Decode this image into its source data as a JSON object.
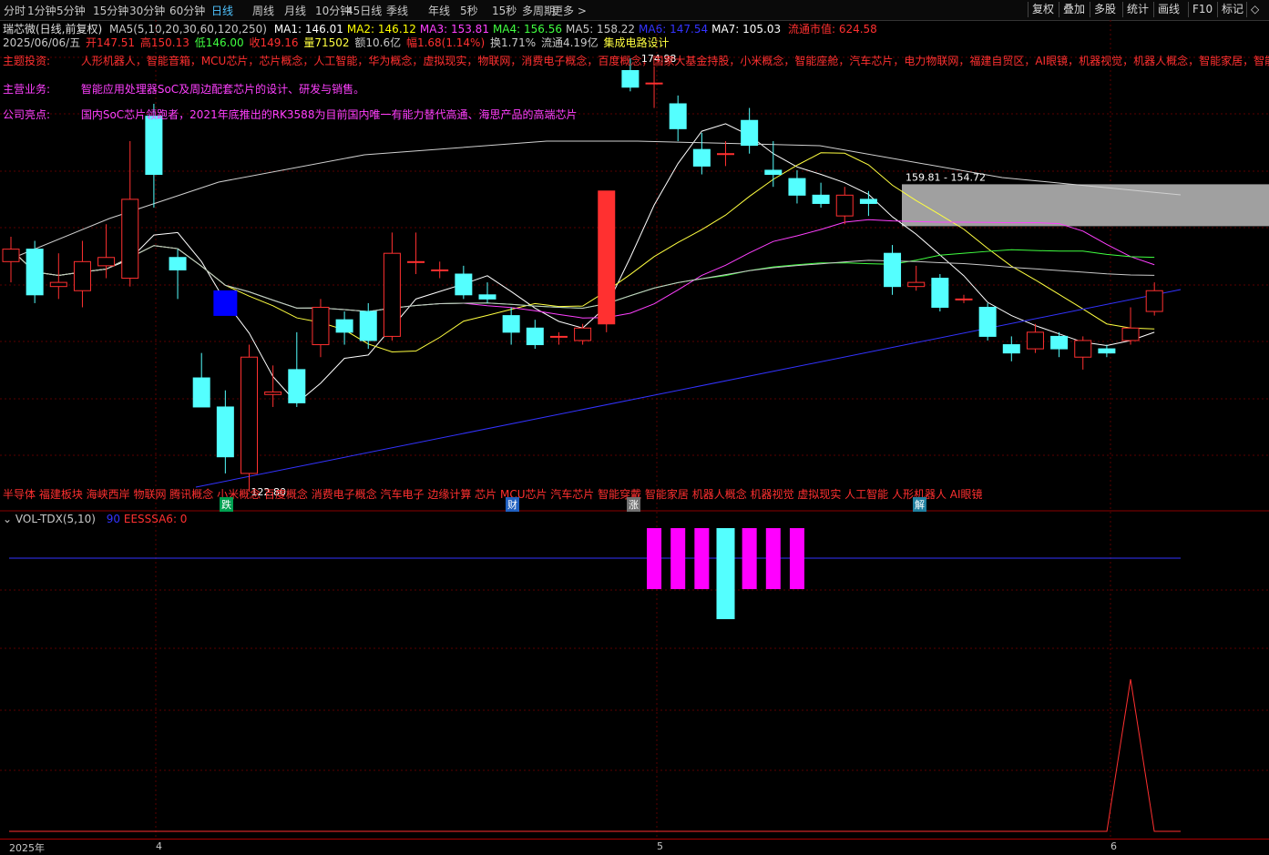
{
  "toolbar": {
    "timeframes": [
      "分时",
      "1分钟",
      "5分钟",
      "15分钟",
      "30分钟",
      "60分钟",
      "日线",
      "周线",
      "月线",
      "10分钟",
      "45日线",
      "季线",
      "年线",
      "5秒",
      "15秒",
      "多周期",
      "更多 >"
    ],
    "active_timeframe": "日线",
    "right_buttons": [
      "复权",
      "叠加",
      "多股",
      "统计",
      "画线",
      "F10",
      "标记",
      "◇"
    ]
  },
  "header": {
    "stock_name": "瑞芯微(日线,前复权)",
    "ma_params": "MA5(5,10,20,30,60,120,250)",
    "ma_values": [
      {
        "label": "MA1: 146.01",
        "color": "#ffffff"
      },
      {
        "label": "MA2: 146.12",
        "color": "#ffff00"
      },
      {
        "label": "MA3: 153.81",
        "color": "#ff40ff"
      },
      {
        "label": "MA4: 156.56",
        "color": "#40ff40"
      },
      {
        "label": "MA5: 158.22",
        "color": "#c8c8c8"
      },
      {
        "label": "MA6: 147.54",
        "color": "#3333ff"
      },
      {
        "label": "MA7: 105.03",
        "color": "#ffffff"
      }
    ],
    "float_mcap": "流通市值: 624.58"
  },
  "quote": {
    "date": "2025/06/06/五",
    "open": "开147.51",
    "high": "高150.13",
    "low": "低146.00",
    "close": "收149.16",
    "volume": "量71502",
    "amount": "额10.6亿",
    "change": "幅1.68(1.14%)",
    "turnover": "换1.71%",
    "float_shares": "流通4.19亿",
    "industry": "集成电路设计"
  },
  "info": {
    "theme_label": "主题投资:",
    "theme_value": "人形机器人，智能音箱，MCU芯片，芯片概念，人工智能，华为概念，虚拟现实，物联网，消费电子概念，百度概念，国家大基金持股，小米概念，智能座舱，汽车芯片，电力物联网，福建自贸区，AI眼镜，机器视觉，机器人概念，智能家居，智能",
    "business_label": "主营业务:",
    "business_value": "智能应用处理器SoC及周边配套芯片的设计、研发与销售。",
    "highlight_label": "公司亮点:",
    "highlight_value": "国内SoC芯片领跑者，2021年底推出的RK3588为目前国内唯一有能力替代高通、海思产品的高端芯片"
  },
  "annotations": {
    "high_price": "174.98",
    "low_price": "122.80",
    "range_box": "159.81 - 154.72"
  },
  "sector_bar": "半导体 福建板块 海峡西岸 物联网 腾讯概念 小米概念 百度概念 消费电子概念 汽车电子 边缘计算 芯片 MCU芯片 汽车芯片 智能穿戴 智能家居 机器人概念 机器视觉 虚拟现实 人工智能 人形机器人 AI眼镜",
  "markers": [
    {
      "text": "跌",
      "color": "#00a050"
    },
    {
      "text": "财",
      "color": "#2060c0"
    },
    {
      "text": "涨",
      "color": "#707070"
    },
    {
      "text": "解",
      "color": "#2080a0"
    }
  ],
  "indicator": {
    "name": "VOL-TDX(5,10)",
    "value1": "90",
    "value2": "EESSSA6: 0"
  },
  "axis": {
    "year": "2025年",
    "months": [
      "4",
      "5",
      "6"
    ]
  },
  "colors": {
    "up": "#ff3030",
    "down": "#54ffff",
    "bg": "#000000",
    "magenta_bar": "#ff00ff"
  },
  "chart_data": {
    "type": "candlestick",
    "price_scale_reference": {
      "high": 174.98,
      "low": 122.8
    },
    "candles": [
      {
        "o": 150.5,
        "c": 152.0,
        "h": 153.5,
        "l": 148.0
      },
      {
        "o": 152.0,
        "c": 146.5,
        "h": 153.0,
        "l": 145.5
      },
      {
        "o": 147.5,
        "c": 148.0,
        "h": 151.5,
        "l": 146.0
      },
      {
        "o": 147.0,
        "c": 150.5,
        "h": 153.0,
        "l": 145.0
      },
      {
        "o": 150.0,
        "c": 151.0,
        "h": 155.0,
        "l": 148.5
      },
      {
        "o": 148.5,
        "c": 158.0,
        "h": 165.0,
        "l": 147.5
      },
      {
        "o": 168.0,
        "c": 161.0,
        "h": 169.5,
        "l": 157.0
      },
      {
        "o": 151.0,
        "c": 149.5,
        "h": 152.0,
        "l": 146.0
      },
      {
        "o": 136.5,
        "c": 133.0,
        "h": 139.5,
        "l": 133.0
      },
      {
        "o": 133.0,
        "c": 127.0,
        "h": 135.0,
        "l": 125.0
      },
      {
        "o": 125.0,
        "c": 139.0,
        "h": 140.5,
        "l": 122.8
      },
      {
        "o": 134.5,
        "c": 134.8,
        "h": 138.0,
        "l": 133.0
      },
      {
        "o": 137.5,
        "c": 133.5,
        "h": 142.0,
        "l": 133.0
      },
      {
        "o": 140.5,
        "c": 145.0,
        "h": 146.0,
        "l": 139.0
      },
      {
        "o": 143.5,
        "c": 142.0,
        "h": 144.5,
        "l": 140.5
      },
      {
        "o": 144.5,
        "c": 141.0,
        "h": 145.5,
        "l": 140.0
      },
      {
        "o": 141.5,
        "c": 151.5,
        "h": 154.0,
        "l": 141.0
      },
      {
        "o": 150.5,
        "c": 150.5,
        "h": 154.0,
        "l": 149.0
      },
      {
        "o": 149.5,
        "c": 149.5,
        "h": 150.5,
        "l": 148.5
      },
      {
        "o": 149.0,
        "c": 146.5,
        "h": 150.0,
        "l": 146.0
      },
      {
        "o": 146.5,
        "c": 146.0,
        "h": 148.0,
        "l": 145.5
      },
      {
        "o": 144.0,
        "c": 142.0,
        "h": 145.0,
        "l": 140.5
      },
      {
        "o": 142.5,
        "c": 140.5,
        "h": 143.5,
        "l": 140.0
      },
      {
        "o": 141.5,
        "c": 141.5,
        "h": 142.0,
        "l": 140.5
      },
      {
        "o": 141.0,
        "c": 142.5,
        "h": 143.0,
        "l": 140.5
      },
      {
        "o": 143.0,
        "c": 159.0,
        "h": 159.0,
        "l": 142.0
      },
      {
        "o": 173.5,
        "c": 171.5,
        "h": 174.98,
        "l": 171.0
      },
      {
        "o": 172.0,
        "c": 172.0,
        "h": 174.0,
        "l": 169.0
      },
      {
        "o": 169.5,
        "c": 166.5,
        "h": 170.5,
        "l": 165.0
      },
      {
        "o": 164.0,
        "c": 162.0,
        "h": 166.0,
        "l": 161.0
      },
      {
        "o": 163.5,
        "c": 163.5,
        "h": 165.0,
        "l": 162.0
      },
      {
        "o": 167.5,
        "c": 164.5,
        "h": 169.0,
        "l": 163.5
      },
      {
        "o": 161.5,
        "c": 161.0,
        "h": 165.0,
        "l": 159.5
      },
      {
        "o": 160.5,
        "c": 158.5,
        "h": 161.5,
        "l": 157.5
      },
      {
        "o": 158.5,
        "c": 157.5,
        "h": 160.0,
        "l": 157.0
      },
      {
        "o": 156.0,
        "c": 158.5,
        "h": 159.5,
        "l": 155.0
      },
      {
        "o": 158.0,
        "c": 157.5,
        "h": 159.0,
        "l": 156.0
      },
      {
        "o": 151.5,
        "c": 147.5,
        "h": 152.5,
        "l": 146.5
      },
      {
        "o": 147.5,
        "c": 148.0,
        "h": 150.0,
        "l": 147.0
      },
      {
        "o": 148.5,
        "c": 145.0,
        "h": 149.0,
        "l": 144.5
      },
      {
        "o": 146.0,
        "c": 146.0,
        "h": 146.5,
        "l": 145.5
      },
      {
        "o": 145.0,
        "c": 141.5,
        "h": 145.5,
        "l": 141.0
      },
      {
        "o": 140.5,
        "c": 139.5,
        "h": 141.5,
        "l": 138.5
      },
      {
        "o": 140.0,
        "c": 142.0,
        "h": 143.0,
        "l": 139.5
      },
      {
        "o": 141.5,
        "c": 140.0,
        "h": 142.0,
        "l": 139.0
      },
      {
        "o": 139.0,
        "c": 141.0,
        "h": 141.5,
        "l": 137.5
      },
      {
        "o": 140.0,
        "c": 139.5,
        "h": 140.5,
        "l": 139.0
      },
      {
        "o": 141.0,
        "c": 142.5,
        "h": 145.0,
        "l": 140.5
      },
      {
        "o": 144.5,
        "c": 147.0,
        "h": 148.0,
        "l": 144.0
      }
    ],
    "blue_block": {
      "index": 9,
      "value": 145.5
    },
    "indicator_bars": [
      {
        "type": "magenta",
        "position": 27
      },
      {
        "type": "magenta",
        "position": 28
      },
      {
        "type": "magenta",
        "position": 29
      },
      {
        "type": "cyan",
        "position": 30
      },
      {
        "type": "magenta",
        "position": 31
      },
      {
        "type": "magenta",
        "position": 32
      },
      {
        "type": "magenta",
        "position": 33
      }
    ],
    "indicator_spike": {
      "position": 47,
      "value": 1
    }
  }
}
